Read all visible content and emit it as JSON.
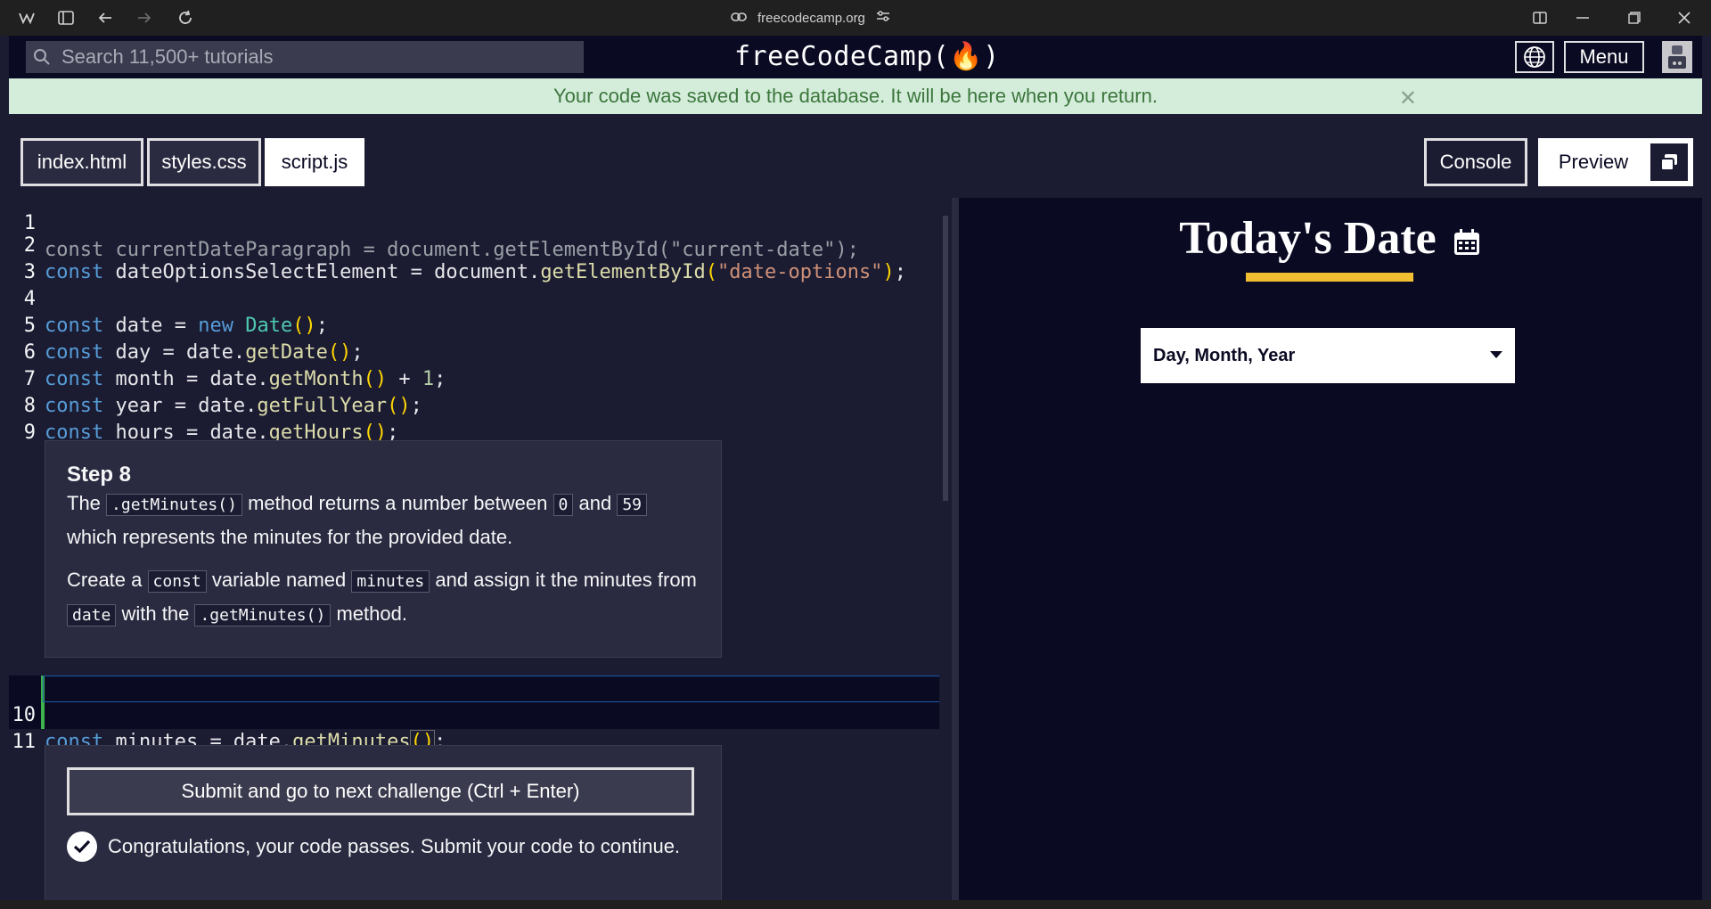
{
  "browser": {
    "url": "freecodecamp.org"
  },
  "navbar": {
    "search_placeholder": "Search 11,500+ tutorials",
    "brand": "freeCodeCamp(🔥)",
    "menu_label": "Menu"
  },
  "flash": {
    "message": "Your code was saved to the database. It will be here when you return."
  },
  "tabs": [
    {
      "label": "index.html"
    },
    {
      "label": "styles.css"
    },
    {
      "label": "script.js"
    }
  ],
  "right_buttons": {
    "console": "Console",
    "preview": "Preview"
  },
  "code_lines": [
    {
      "n": "1"
    },
    {
      "n": "2"
    },
    {
      "n": "3"
    },
    {
      "n": "4"
    },
    {
      "n": "5"
    },
    {
      "n": "6"
    },
    {
      "n": "7"
    },
    {
      "n": "8"
    },
    {
      "n": "9"
    },
    {
      "n": "10"
    },
    {
      "n": "11"
    }
  ],
  "code": {
    "l1": "const currentDateParagraph = document.getElementById(\"current-date\");",
    "l2_kw": "const",
    "l2_var": " dateOptionsSelectElement = document.",
    "l2_fn": "getElementById",
    "l2_str": "\"date-options\"",
    "l4_var": " date = ",
    "l4_new": "new",
    "l4_cls": "Date",
    "l5_var": " day = date.",
    "l5_fn": "getDate",
    "l6_var": " month = date.",
    "l6_fn": "getMonth",
    "l6_num": "1",
    "l7_var": " year = date.",
    "l7_fn": "getFullYear",
    "l8_var": " hours = date.",
    "l8_fn": "getHours",
    "l10_var": " minutes = date.",
    "l10_fn": "getMinutes"
  },
  "step": {
    "title": "Step 8",
    "p1_a": "The",
    "p1_code1": ".getMinutes()",
    "p1_b": "method returns a number between",
    "p1_code2": "0",
    "p1_c": "and",
    "p1_code3": "59",
    "p1_d": "which represents the minutes for the provided date.",
    "p2_a": "Create a",
    "p2_code1": "const",
    "p2_b": "variable named",
    "p2_code2": "minutes",
    "p2_c": "and assign it the minutes",
    "p2_d": "from",
    "p2_code3": "date",
    "p2_e": "with the",
    "p2_code4": ".getMinutes()",
    "p2_f": "method."
  },
  "submit": {
    "button": "Submit and go to next challenge (Ctrl + Enter)",
    "pass_text": "Congratulations, your code passes. Submit your code to continue."
  },
  "preview": {
    "title": "Today's Date",
    "select_value": "Day, Month, Year",
    "accent": "#f1be32"
  }
}
